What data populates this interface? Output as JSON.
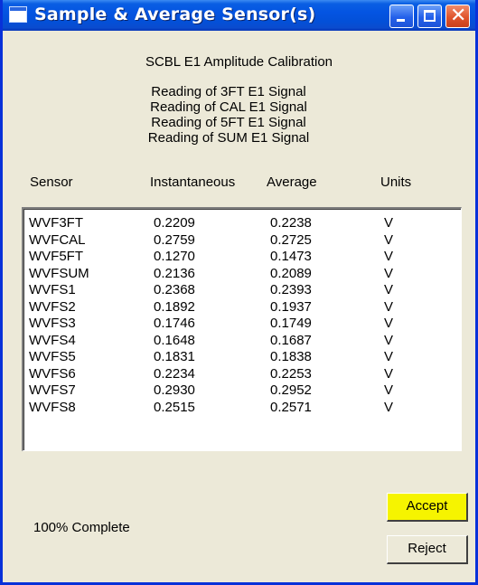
{
  "window": {
    "title": "Sample & Average Sensor(s)",
    "close_glyph": "✕"
  },
  "heading": "SCBL E1 Amplitude Calibration",
  "readings": [
    "Reading of 3FT E1 Signal",
    "Reading of CAL E1 Signal",
    "Reading of 5FT E1 Signal",
    "Reading of SUM E1 Signal"
  ],
  "columns": {
    "sensor": "Sensor",
    "instantaneous": "Instantaneous",
    "average": "Average",
    "units": "Units"
  },
  "rows": [
    {
      "sensor": "WVF3FT",
      "inst": "0.2209",
      "avg": "0.2238",
      "units": "V"
    },
    {
      "sensor": "WVFCAL",
      "inst": "0.2759",
      "avg": "0.2725",
      "units": "V"
    },
    {
      "sensor": "WVF5FT",
      "inst": "0.1270",
      "avg": "0.1473",
      "units": "V"
    },
    {
      "sensor": "WVFSUM",
      "inst": "0.2136",
      "avg": "0.2089",
      "units": "V"
    },
    {
      "sensor": "WVFS1",
      "inst": "0.2368",
      "avg": "0.2393",
      "units": "V"
    },
    {
      "sensor": "WVFS2",
      "inst": "0.1892",
      "avg": "0.1937",
      "units": "V"
    },
    {
      "sensor": "WVFS3",
      "inst": "0.1746",
      "avg": "0.1749",
      "units": "V"
    },
    {
      "sensor": "WVFS4",
      "inst": "0.1648",
      "avg": "0.1687",
      "units": "V"
    },
    {
      "sensor": "WVFS5",
      "inst": "0.1831",
      "avg": "0.1838",
      "units": "V"
    },
    {
      "sensor": "WVFS6",
      "inst": "0.2234",
      "avg": "0.2253",
      "units": "V"
    },
    {
      "sensor": "WVFS7",
      "inst": "0.2930",
      "avg": "0.2952",
      "units": "V"
    },
    {
      "sensor": "WVFS8",
      "inst": "0.2515",
      "avg": "0.2571",
      "units": "V"
    }
  ],
  "status": "100% Complete",
  "buttons": {
    "accept": "Accept",
    "reject": "Reject"
  },
  "colors": {
    "titlebar": "#0454e2",
    "accept_highlight": "#f6f400"
  }
}
